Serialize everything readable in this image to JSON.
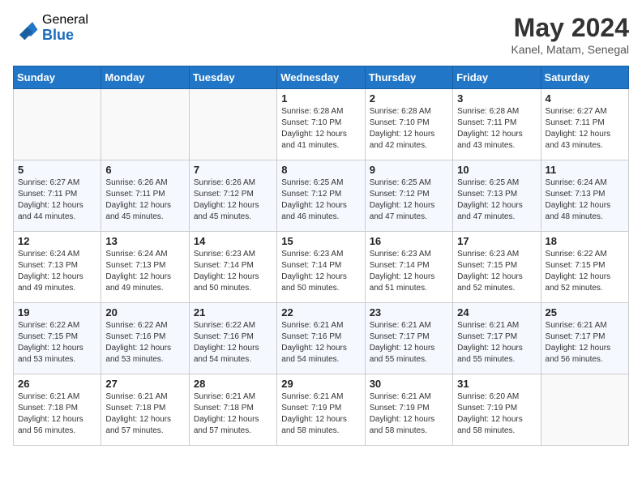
{
  "header": {
    "logo_general": "General",
    "logo_blue": "Blue",
    "month_title": "May 2024",
    "location": "Kanel, Matam, Senegal"
  },
  "weekdays": [
    "Sunday",
    "Monday",
    "Tuesday",
    "Wednesday",
    "Thursday",
    "Friday",
    "Saturday"
  ],
  "weeks": [
    [
      {
        "day": "",
        "info": ""
      },
      {
        "day": "",
        "info": ""
      },
      {
        "day": "",
        "info": ""
      },
      {
        "day": "1",
        "info": "Sunrise: 6:28 AM\nSunset: 7:10 PM\nDaylight: 12 hours and 41 minutes."
      },
      {
        "day": "2",
        "info": "Sunrise: 6:28 AM\nSunset: 7:10 PM\nDaylight: 12 hours and 42 minutes."
      },
      {
        "day": "3",
        "info": "Sunrise: 6:28 AM\nSunset: 7:11 PM\nDaylight: 12 hours and 43 minutes."
      },
      {
        "day": "4",
        "info": "Sunrise: 6:27 AM\nSunset: 7:11 PM\nDaylight: 12 hours and 43 minutes."
      }
    ],
    [
      {
        "day": "5",
        "info": "Sunrise: 6:27 AM\nSunset: 7:11 PM\nDaylight: 12 hours and 44 minutes."
      },
      {
        "day": "6",
        "info": "Sunrise: 6:26 AM\nSunset: 7:11 PM\nDaylight: 12 hours and 45 minutes."
      },
      {
        "day": "7",
        "info": "Sunrise: 6:26 AM\nSunset: 7:12 PM\nDaylight: 12 hours and 45 minutes."
      },
      {
        "day": "8",
        "info": "Sunrise: 6:25 AM\nSunset: 7:12 PM\nDaylight: 12 hours and 46 minutes."
      },
      {
        "day": "9",
        "info": "Sunrise: 6:25 AM\nSunset: 7:12 PM\nDaylight: 12 hours and 47 minutes."
      },
      {
        "day": "10",
        "info": "Sunrise: 6:25 AM\nSunset: 7:13 PM\nDaylight: 12 hours and 47 minutes."
      },
      {
        "day": "11",
        "info": "Sunrise: 6:24 AM\nSunset: 7:13 PM\nDaylight: 12 hours and 48 minutes."
      }
    ],
    [
      {
        "day": "12",
        "info": "Sunrise: 6:24 AM\nSunset: 7:13 PM\nDaylight: 12 hours and 49 minutes."
      },
      {
        "day": "13",
        "info": "Sunrise: 6:24 AM\nSunset: 7:13 PM\nDaylight: 12 hours and 49 minutes."
      },
      {
        "day": "14",
        "info": "Sunrise: 6:23 AM\nSunset: 7:14 PM\nDaylight: 12 hours and 50 minutes."
      },
      {
        "day": "15",
        "info": "Sunrise: 6:23 AM\nSunset: 7:14 PM\nDaylight: 12 hours and 50 minutes."
      },
      {
        "day": "16",
        "info": "Sunrise: 6:23 AM\nSunset: 7:14 PM\nDaylight: 12 hours and 51 minutes."
      },
      {
        "day": "17",
        "info": "Sunrise: 6:23 AM\nSunset: 7:15 PM\nDaylight: 12 hours and 52 minutes."
      },
      {
        "day": "18",
        "info": "Sunrise: 6:22 AM\nSunset: 7:15 PM\nDaylight: 12 hours and 52 minutes."
      }
    ],
    [
      {
        "day": "19",
        "info": "Sunrise: 6:22 AM\nSunset: 7:15 PM\nDaylight: 12 hours and 53 minutes."
      },
      {
        "day": "20",
        "info": "Sunrise: 6:22 AM\nSunset: 7:16 PM\nDaylight: 12 hours and 53 minutes."
      },
      {
        "day": "21",
        "info": "Sunrise: 6:22 AM\nSunset: 7:16 PM\nDaylight: 12 hours and 54 minutes."
      },
      {
        "day": "22",
        "info": "Sunrise: 6:21 AM\nSunset: 7:16 PM\nDaylight: 12 hours and 54 minutes."
      },
      {
        "day": "23",
        "info": "Sunrise: 6:21 AM\nSunset: 7:17 PM\nDaylight: 12 hours and 55 minutes."
      },
      {
        "day": "24",
        "info": "Sunrise: 6:21 AM\nSunset: 7:17 PM\nDaylight: 12 hours and 55 minutes."
      },
      {
        "day": "25",
        "info": "Sunrise: 6:21 AM\nSunset: 7:17 PM\nDaylight: 12 hours and 56 minutes."
      }
    ],
    [
      {
        "day": "26",
        "info": "Sunrise: 6:21 AM\nSunset: 7:18 PM\nDaylight: 12 hours and 56 minutes."
      },
      {
        "day": "27",
        "info": "Sunrise: 6:21 AM\nSunset: 7:18 PM\nDaylight: 12 hours and 57 minutes."
      },
      {
        "day": "28",
        "info": "Sunrise: 6:21 AM\nSunset: 7:18 PM\nDaylight: 12 hours and 57 minutes."
      },
      {
        "day": "29",
        "info": "Sunrise: 6:21 AM\nSunset: 7:19 PM\nDaylight: 12 hours and 58 minutes."
      },
      {
        "day": "30",
        "info": "Sunrise: 6:21 AM\nSunset: 7:19 PM\nDaylight: 12 hours and 58 minutes."
      },
      {
        "day": "31",
        "info": "Sunrise: 6:20 AM\nSunset: 7:19 PM\nDaylight: 12 hours and 58 minutes."
      },
      {
        "day": "",
        "info": ""
      }
    ]
  ]
}
